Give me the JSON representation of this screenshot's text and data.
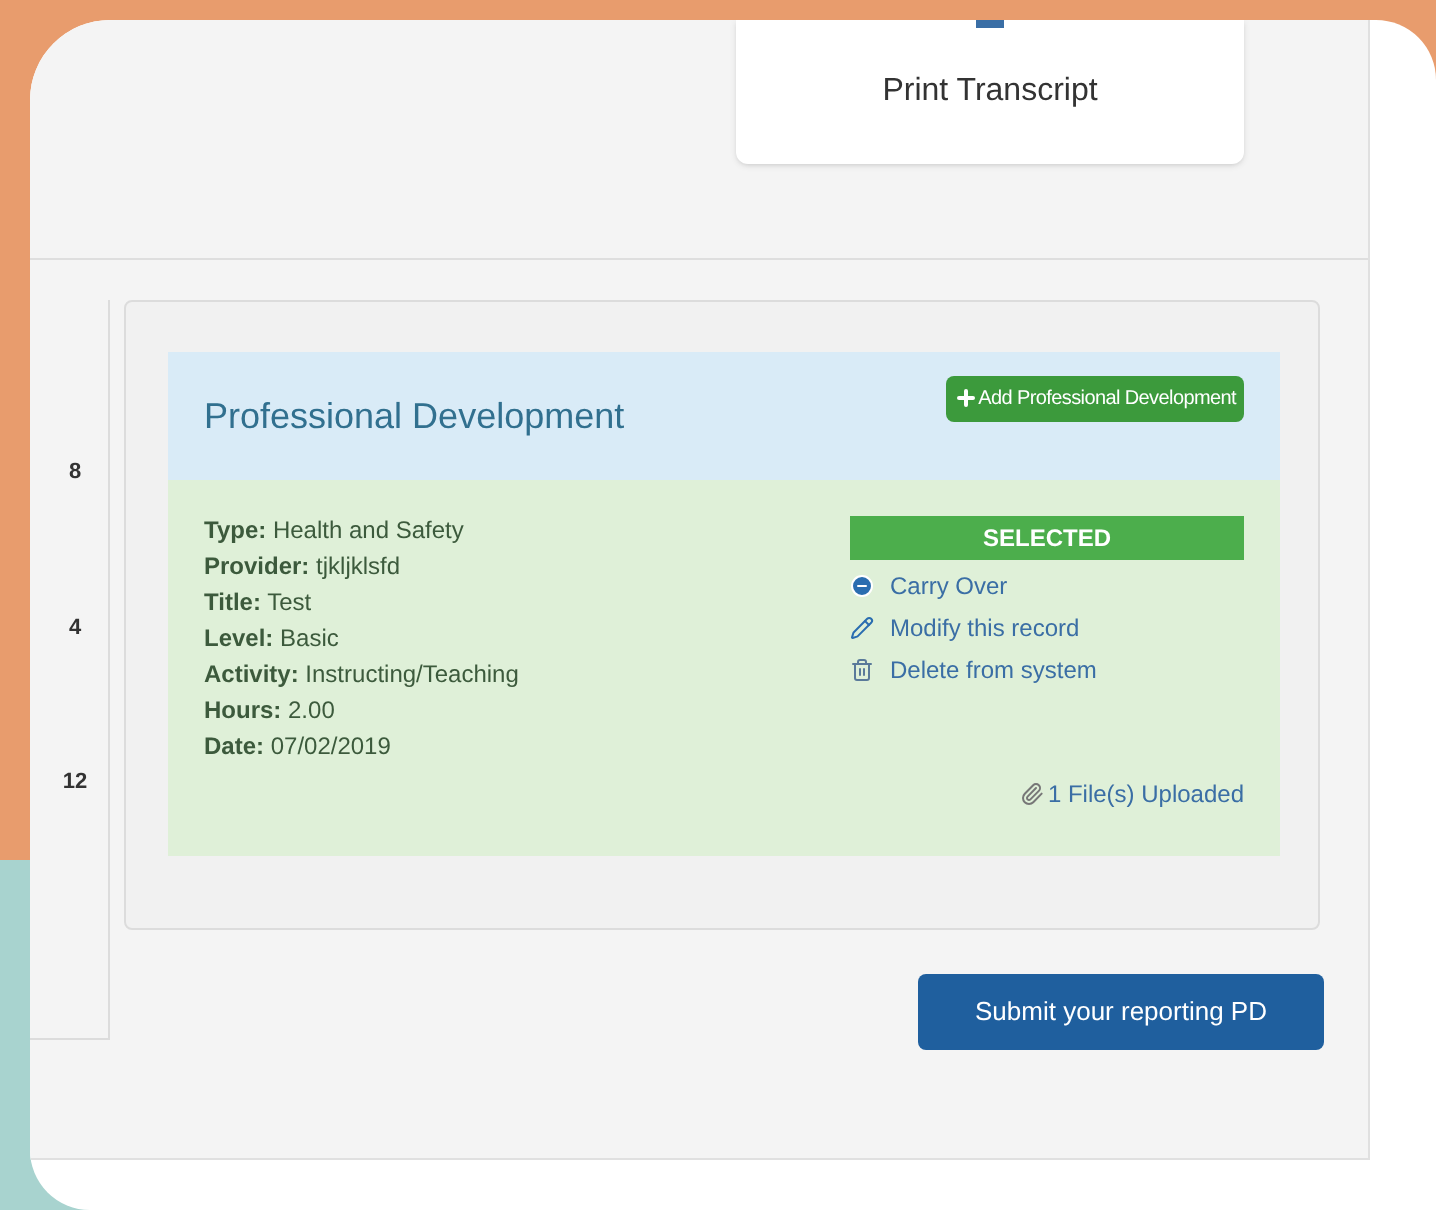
{
  "print_button": {
    "label": "Print Transcript"
  },
  "side_numbers": [
    "8",
    "4",
    "12"
  ],
  "panel": {
    "title": "Professional Development",
    "add_button": "Add Professional Development",
    "fields": [
      "**Type:** Health and Safety",
      "**Provider:** tjkljklsfd",
      "**Title:** Test",
      "**Level:** Basic",
      "**Activity:** Instructing/Teaching",
      "**Hours:** 2.00",
      "**Date:** 07/02/2019"
    ],
    "status": "SELECTED",
    "actions": [
      {
        "kind": "carry",
        "label": "Carry Over"
      },
      {
        "kind": "edit",
        "label": "Modify this record"
      },
      {
        "kind": "delete",
        "label": "Delete from system"
      }
    ],
    "files": "1 File(s) Uploaded"
  },
  "submit_button": "Submit your reporting PD"
}
